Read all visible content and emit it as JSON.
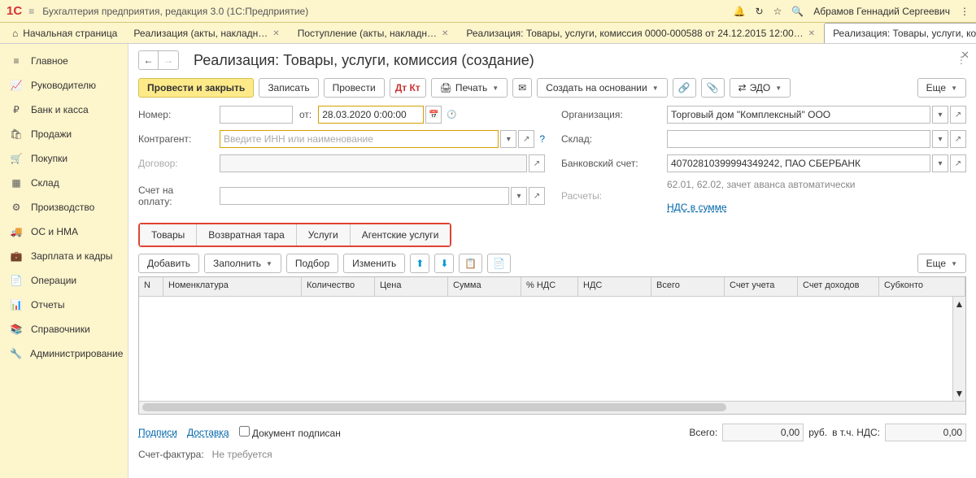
{
  "top": {
    "logo": "1С",
    "title": "Бухгалтерия предприятия, редакция 3.0   (1С:Предприятие)",
    "user": "Абрамов Геннадий Сергеевич"
  },
  "tabs": {
    "home": "Начальная страница",
    "t1": "Реализация (акты, накладн…",
    "t2": "Поступление (акты, накладн…",
    "t3": "Реализация: Товары, услуги, комиссия 0000-000588 от 24.12.2015 12:00…",
    "t4": "Реализация: Товары, услуги, комиссия (создан…"
  },
  "sidebar": [
    "Главное",
    "Руководителю",
    "Банк и касса",
    "Продажи",
    "Покупки",
    "Склад",
    "Производство",
    "ОС и НМА",
    "Зарплата и кадры",
    "Операции",
    "Отчеты",
    "Справочники",
    "Администрирование"
  ],
  "page": {
    "title": "Реализация: Товары, услуги, комиссия (создание)",
    "buttons": {
      "post_close": "Провести и закрыть",
      "save": "Записать",
      "post": "Провести",
      "print": "Печать",
      "create_based": "Создать на основании",
      "edo": "ЭДО",
      "more": "Еще"
    },
    "form": {
      "number_lbl": "Номер:",
      "from_lbl": "от:",
      "date": "28.03.2020  0:00:00",
      "org_lbl": "Организация:",
      "org": "Торговый дом \"Комплексный\" ООО",
      "counterparty_lbl": "Контрагент:",
      "counterparty_ph": "Введите ИНН или наименование",
      "warehouse_lbl": "Склад:",
      "contract_lbl": "Договор:",
      "bank_lbl": "Банковский счет:",
      "bank": "40702810399994349242, ПАО СБЕРБАНК",
      "invoice_lbl": "Счет на оплату:",
      "settlements_lbl": "Расчеты:",
      "settlements": "62.01, 62.02, зачет аванса автоматически",
      "vat_link": "НДС в сумме"
    },
    "subtabs": [
      "Товары",
      "Возвратная тара",
      "Услуги",
      "Агентские услуги"
    ],
    "tbl_buttons": {
      "add": "Добавить",
      "fill": "Заполнить",
      "pick": "Подбор",
      "edit": "Изменить"
    },
    "columns": [
      "N",
      "Номенклатура",
      "Количество",
      "Цена",
      "Сумма",
      "% НДС",
      "НДС",
      "Всего",
      "Счет учета",
      "Счет доходов",
      "Субконто"
    ],
    "footer": {
      "signs": "Подписи",
      "delivery": "Доставка",
      "doc_signed": "Документ подписан",
      "total_lbl": "Всего:",
      "total": "0,00",
      "currency": "руб.",
      "vat_lbl": "в т.ч. НДС:",
      "vat": "0,00",
      "invoice_doc_lbl": "Счет-фактура:",
      "invoice_doc": "Не требуется"
    }
  }
}
